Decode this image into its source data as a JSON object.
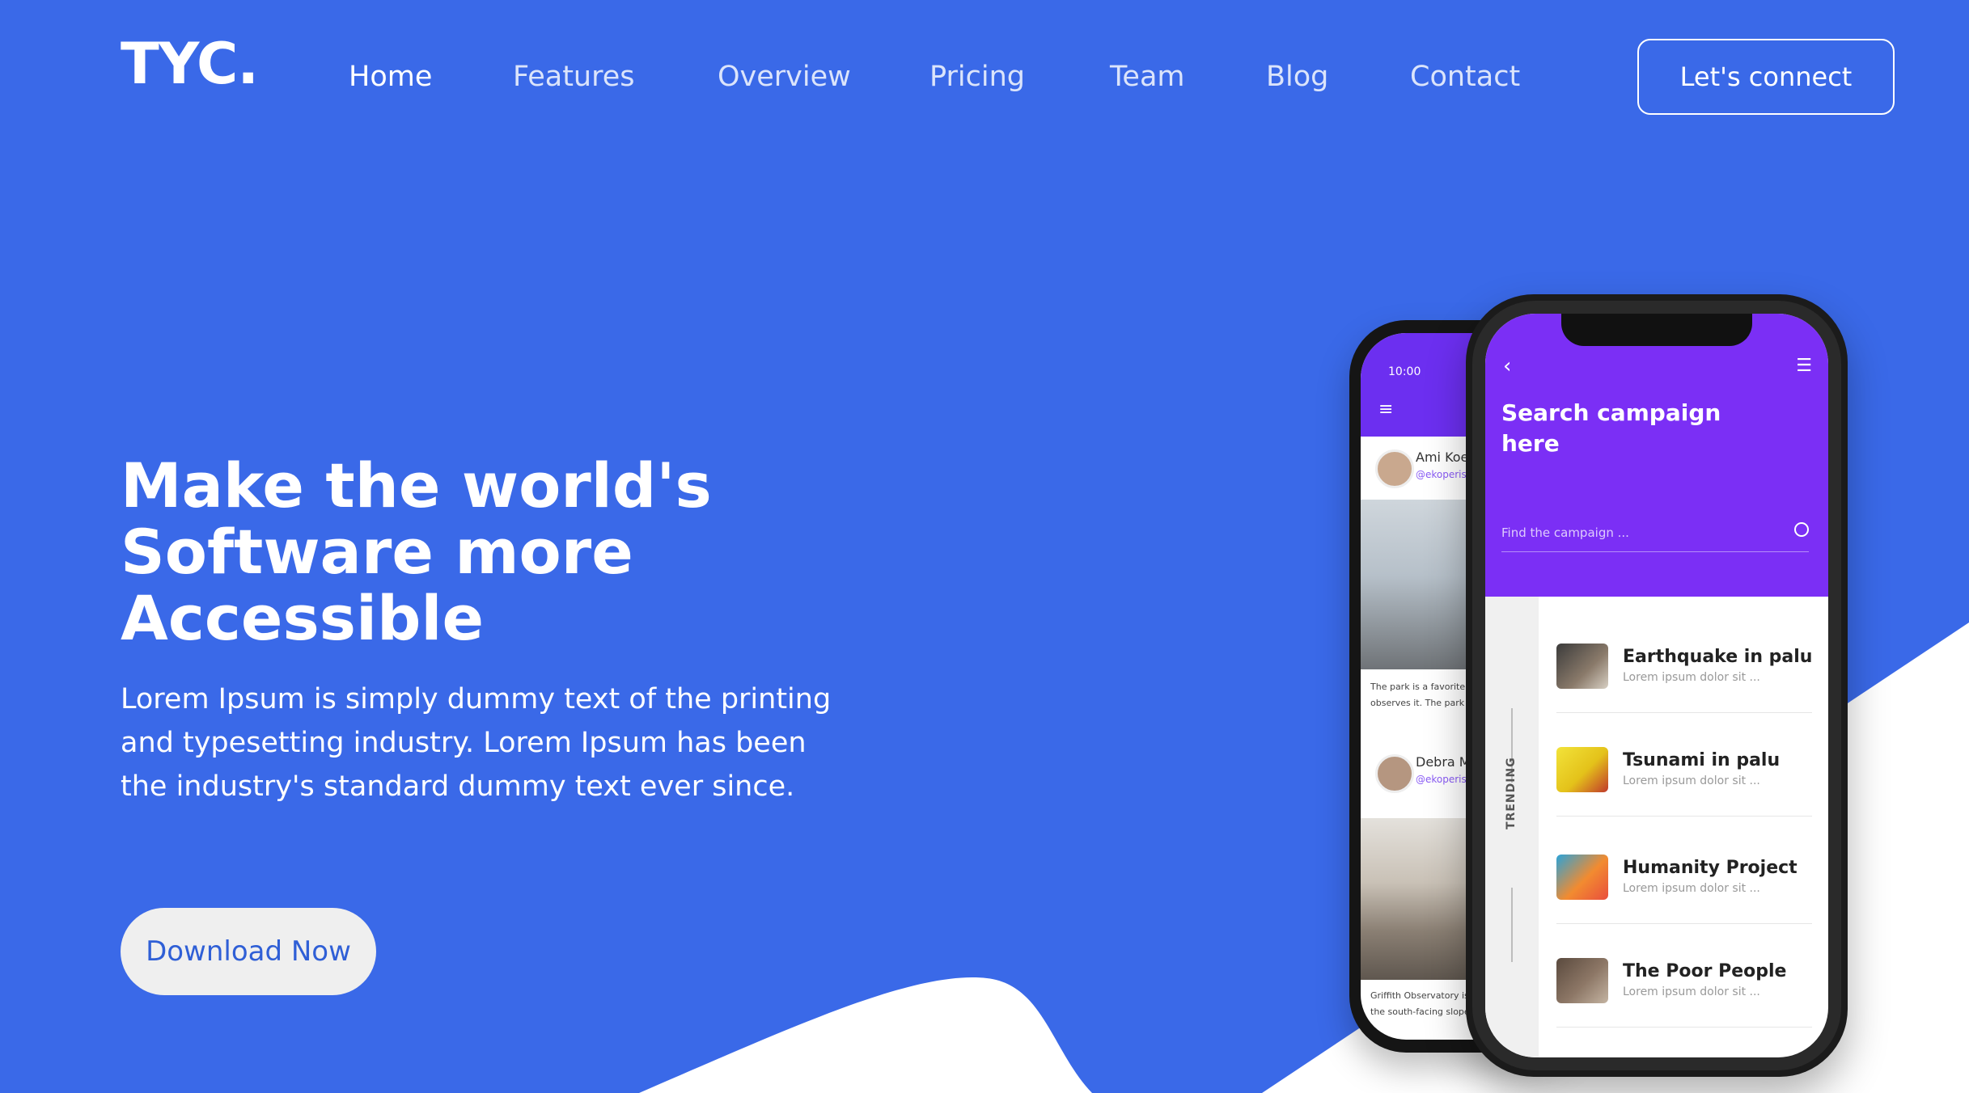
{
  "brand": {
    "logo": "TYC."
  },
  "nav": {
    "items": [
      {
        "label": "Home",
        "active": true
      },
      {
        "label": "Features"
      },
      {
        "label": "Overview"
      },
      {
        "label": "Pricing"
      },
      {
        "label": "Team"
      },
      {
        "label": "Blog"
      },
      {
        "label": "Contact"
      }
    ],
    "cta_label": "Let's connect"
  },
  "hero": {
    "title": "Make the world's Software more Accessible",
    "subtitle": "Lorem Ipsum is simply dummy text of the printing and typesetting industry. Lorem Ipsum has been the industry's standard dummy text ever since.",
    "download_label": "Download Now"
  },
  "phone_back": {
    "time": "10:00",
    "menu_icon": "hamburger-icon",
    "posts": [
      {
        "name": "Ami Koehler",
        "handle": "@ekoperish",
        "caption1": "The park is a favorite among ska",
        "caption2": "observes it. The park is comple"
      },
      {
        "name": "Debra Mcmunn",
        "handle": "@ekoperish",
        "caption1": "Griffith Observatory is a facility in",
        "caption2": "the south-facing slope of Mou"
      }
    ]
  },
  "phone_front": {
    "back_icon": "chevron-left-icon",
    "filter_icon": "sliders-icon",
    "title": "Search campaign here",
    "search_placeholder": "Find the campaign ...",
    "search_icon": "search-icon",
    "sidebar_label": "TRENDING",
    "items": [
      {
        "title": "Earthquake in palu",
        "subtitle": "Lorem ipsum dolor sit ..."
      },
      {
        "title": "Tsunami in palu",
        "subtitle": "Lorem ipsum dolor sit ..."
      },
      {
        "title": "Humanity Project",
        "subtitle": "Lorem ipsum dolor sit ..."
      },
      {
        "title": "The Poor People",
        "subtitle": "Lorem ipsum dolor sit ..."
      }
    ]
  },
  "colors": {
    "background": "#3a69e8",
    "wave": "#ffffff",
    "phone_accent": "#7b2ff5",
    "download_text": "#2f5fd6"
  }
}
